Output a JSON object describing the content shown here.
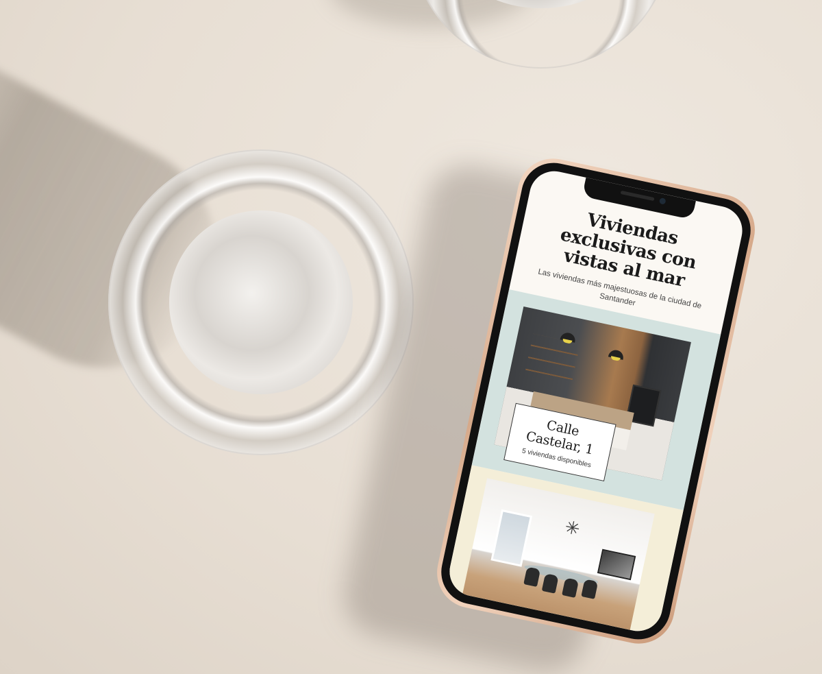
{
  "phone_screen": {
    "hero": {
      "title": "Viviendas exclusivas con vistas al mar",
      "subtitle": "Las viviendas más majestuosas de la ciudad de Santander"
    },
    "listings": [
      {
        "name": "Calle Castelar, 1",
        "availability": "5 viviendas disponibles",
        "photo": "kitchen-interior",
        "background": "#d3e2df"
      },
      {
        "photo": "dining-living-room",
        "background": "#f4eed8"
      }
    ]
  },
  "colors": {
    "backdrop": "#e8e0d6",
    "phone_frame": "#d6a98a",
    "screen_bg": "#fbf8f3"
  }
}
